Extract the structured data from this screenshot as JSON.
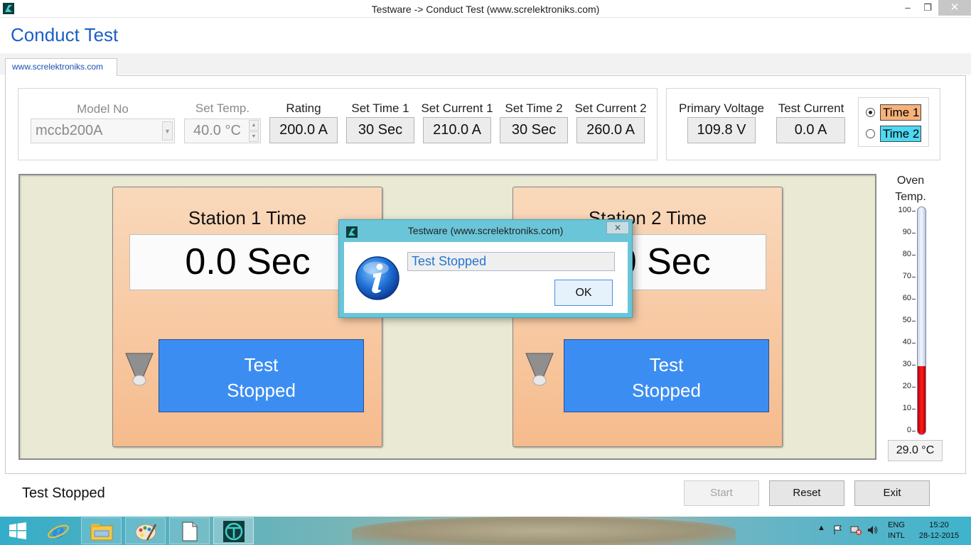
{
  "window": {
    "title": "Testware -> Conduct Test (www.screlektroniks.com)",
    "minimize_glyph": "–",
    "maximize_glyph": "❐",
    "close_glyph": "✕"
  },
  "page_title": "Conduct Test",
  "tab_label": "www.screlektroniks.com",
  "settings": {
    "model_no_label": "Model No",
    "model_no_value": "mccb200A",
    "set_temp_label": "Set Temp.",
    "set_temp_value": "40.0 °C",
    "rating_label": "Rating",
    "rating_value": "200.0 A",
    "set_time1_label": "Set Time 1",
    "set_time1_value": "30 Sec",
    "set_current1_label": "Set Current 1",
    "set_current1_value": "210.0 A",
    "set_time2_label": "Set Time 2",
    "set_time2_value": "30 Sec",
    "set_current2_label": "Set Current 2",
    "set_current2_value": "260.0 A"
  },
  "readings": {
    "primary_voltage_label": "Primary Voltage",
    "primary_voltage_value": "109.8 V",
    "test_current_label": "Test Current",
    "test_current_value": "0.0 A"
  },
  "time_select": {
    "options": [
      {
        "label": "Time 1",
        "selected": true,
        "color": "#f7b27a"
      },
      {
        "label": "Time 2",
        "selected": false,
        "color": "#4fd8f2"
      }
    ]
  },
  "stations": [
    {
      "title": "Station 1 Time",
      "time": "0.0 Sec",
      "status": "Test\nStopped"
    },
    {
      "title": "Station 2 Time",
      "time": "0.0 Sec",
      "status": "Test\nStopped"
    }
  ],
  "oven": {
    "label": "Oven\nTemp.",
    "ticks": [
      "100",
      "90",
      "80",
      "70",
      "60",
      "50",
      "40",
      "30",
      "20",
      "10",
      "0"
    ],
    "level_percent": 29,
    "reading": "29.0 °C"
  },
  "status_text": "Test Stopped",
  "buttons": {
    "start": "Start",
    "reset": "Reset",
    "exit": "Exit"
  },
  "dialog": {
    "title": "Testware (www.screlektroniks.com)",
    "message": "Test Stopped",
    "ok": "OK",
    "close_glyph": "✕"
  },
  "taskbar": {
    "lang_top": "ENG",
    "lang_bottom": "INTL",
    "time": "15:20",
    "date": "28-12-2015"
  },
  "colors": {
    "accent_title": "#1a5fc7",
    "status_button": "#3c8df2",
    "thermo_fill": "#e00000"
  }
}
